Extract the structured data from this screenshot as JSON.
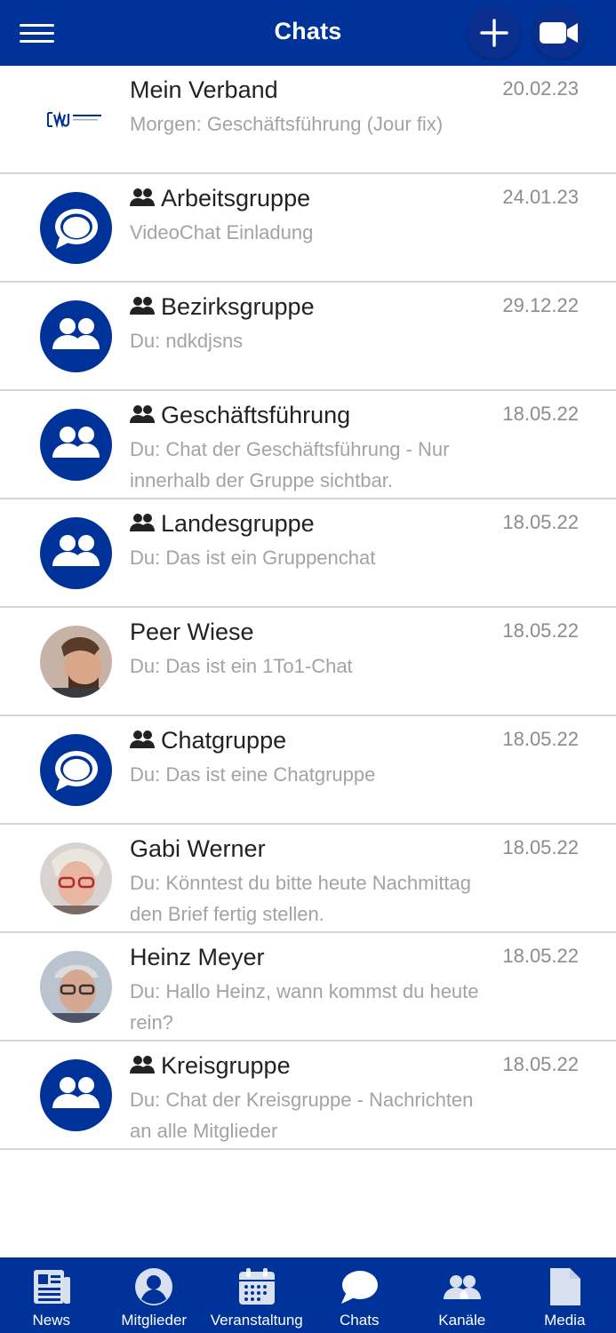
{
  "header": {
    "title": "Chats",
    "menu_icon": "hamburger-menu-icon",
    "add_icon": "plus-icon",
    "video_icon": "video-camera-icon"
  },
  "colors": {
    "primary": "#003399",
    "date_text": "#8c8c8c",
    "preview_text": "#a3a3a3",
    "divider": "#d4d4d4"
  },
  "chats": [
    {
      "name": "Mein Verband",
      "date": "20.02.23",
      "preview": "Morgen: Geschäftsführung (Jour fix)",
      "group": false,
      "avatar": "wj-logo"
    },
    {
      "name": "Arbeitsgruppe",
      "date": "24.01.23",
      "preview": "VideoChat Einladung",
      "group": true,
      "avatar": "chat-bubbles-icon"
    },
    {
      "name": "Bezirksgruppe",
      "date": "29.12.22",
      "preview": "Du: ndkdjsns",
      "group": true,
      "avatar": "users-icon"
    },
    {
      "name": "Geschäftsführung",
      "date": "18.05.22",
      "preview": "Du: Chat der Geschäftsführung - Nur innerhalb der Gruppe sichtbar.",
      "group": true,
      "avatar": "users-icon"
    },
    {
      "name": "Landesgruppe",
      "date": "18.05.22",
      "preview": "Du: Das ist ein Gruppenchat",
      "group": true,
      "avatar": "users-icon"
    },
    {
      "name": "Peer Wiese",
      "date": "18.05.22",
      "preview": "Du: Das ist ein 1To1-Chat",
      "group": false,
      "avatar": "photo-man-beard"
    },
    {
      "name": "Chatgruppe",
      "date": "18.05.22",
      "preview": "Du: Das ist eine Chatgruppe",
      "group": true,
      "avatar": "chat-bubbles-icon"
    },
    {
      "name": "Gabi Werner",
      "date": "18.05.22",
      "preview": "Du: Könntest du bitte heute Nachmittag den Brief fertig stellen.",
      "group": false,
      "avatar": "photo-woman-glasses"
    },
    {
      "name": "Heinz Meyer",
      "date": "18.05.22",
      "preview": "Du: Hallo Heinz, wann kommst du heute rein?",
      "group": false,
      "avatar": "photo-man-glasses"
    },
    {
      "name": "Kreisgruppe",
      "date": "18.05.22",
      "preview": "Du: Chat der Kreisgruppe - Nachrichten an alle Mitglieder",
      "group": true,
      "avatar": "users-icon"
    }
  ],
  "tabs": [
    {
      "label": "News",
      "icon": "newspaper-icon",
      "active": false
    },
    {
      "label": "Mitglieder",
      "icon": "user-circle-icon",
      "active": false
    },
    {
      "label": "Veranstaltung",
      "icon": "calendar-icon",
      "active": false
    },
    {
      "label": "Chats",
      "icon": "chat-bubbles-icon",
      "active": true
    },
    {
      "label": "Kanäle",
      "icon": "users-icon",
      "active": false
    },
    {
      "label": "Media",
      "icon": "document-icon",
      "active": false
    }
  ]
}
